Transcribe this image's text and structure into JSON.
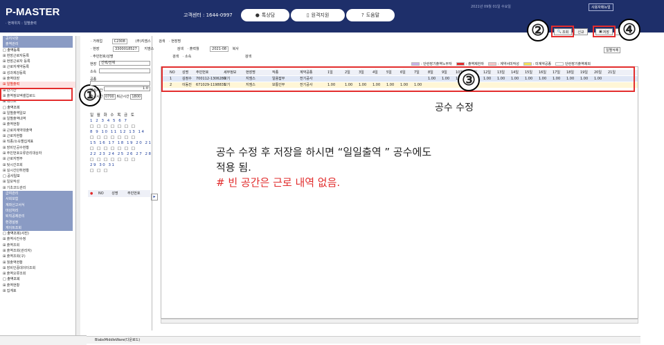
{
  "header": {
    "logo": "P-MASTER",
    "location": "· 현재위치 : 일별출력",
    "call_center": "고객센터 : 1644-0997",
    "btn1": "톡상담",
    "btn2": "원격지원",
    "btn3": "도움말",
    "date_text": "2021년 09월 01일 수요일",
    "user_tag": "사용자매뉴얼"
  },
  "toolbar": {
    "search": "조회",
    "init": "신규",
    "save": "저장",
    "third": "인쇄"
  },
  "callouts": {
    "c1": "①",
    "c2": "②",
    "c3": "③",
    "c4": "④"
  },
  "form": {
    "l1": "· 거래업",
    "v1a": "C2308",
    "v1b": "(주)지엠스",
    "search1": "검색",
    "l2": "· 현장",
    "v2a": "3300018527",
    "v2b": "지엠스",
    "search2": "검색",
    "l3": "· 주민번호/성명",
    "l4": "· 현장명",
    "l5": "· 출력월",
    "v5": "2021-08",
    "copy": "복사",
    "l6": "· 소속",
    "search3": "검색"
  },
  "daily_btn": "일별삭제",
  "legend": [
    {
      "color": "#c8b4e6",
      "label": ": 단란장기출역노무자"
    },
    {
      "color": "#e32c2c",
      "label": ": 출역제한자"
    },
    {
      "color": "#f2c6c6",
      "label": ": 계약서미작성"
    },
    {
      "color": "#f3e05a",
      "label": ": 미계약공종"
    },
    {
      "color": "#ffffff",
      "label": "단란장기출역제외"
    }
  ],
  "grid": {
    "headers": [
      "NO",
      "성명",
      "주민번호",
      "세부정보",
      "현장명",
      "작종",
      "계약공종",
      "1일",
      "2일",
      "3일",
      "4일",
      "5일",
      "6일",
      "7일",
      "8일",
      "9일",
      "10일",
      "11일",
      "12일",
      "13일",
      "14일",
      "15일",
      "16일",
      "17일",
      "18일",
      "19일",
      "20일",
      "21일"
    ],
    "rows": [
      {
        "no": "1",
        "name": "김정수",
        "id": "700112-1306280",
        "info": "보기",
        "site": "지엠스",
        "job": "일용잡부",
        "contract": "전기공사",
        "days": [
          "",
          "",
          "",
          "",
          "",
          "",
          "",
          "1.00",
          "1.00",
          "1.00",
          "1.00",
          "1.00",
          "1.00",
          "1.00",
          "1.00",
          "1.00",
          "1.00",
          "1.00",
          "1.00",
          "1.00"
        ]
      },
      {
        "no": "2",
        "name": "이동진",
        "id": "671029-1198831",
        "info": "보기",
        "site": "지엠스",
        "job": "보통인부",
        "contract": "전기공사",
        "days": [
          "1.00",
          "1.00",
          "1.00",
          "1.00",
          "1.00",
          "1.00",
          "1.00",
          "",
          "",
          "",
          "",
          "",
          "",
          "",
          "",
          "",
          "",
          "",
          "",
          ""
        ]
      }
    ]
  },
  "left_panel": {
    "site_label": "현장",
    "site_value": "선택/전체",
    "org_label": "소속",
    "type_label": "공종",
    "lunch_label": "점심시간",
    "lunch_value": "1.0",
    "time_label": "출근시간",
    "time_in": "0700",
    "leave_label": "퇴근시간",
    "time_out": "1800",
    "week": "일 월 화 수 목 금 토",
    "cal_rows": [
      "1 2 3 4 5 6 7",
      "8 9 10 11 12 13 14",
      "15 16 17 18 19 20 21",
      "22 23 24 25 26 27 28",
      "29 30 31"
    ],
    "list_headers": [
      "NO",
      "성명",
      "주민번호"
    ]
  },
  "sidebar": [
    {
      "t": "sh",
      "label": "공지사항"
    },
    {
      "t": "sh",
      "label": "출역관리"
    },
    {
      "t": "sf",
      "label": "□ 출역등록"
    },
    {
      "t": "sc",
      "label": "⊞ 현장근로자등록"
    },
    {
      "t": "sc",
      "label": "⊞ 현장근로자 등록"
    },
    {
      "t": "sc",
      "label": "⊞ 근로자계약등록"
    },
    {
      "t": "sc",
      "label": "⊞ 성과제강등록"
    },
    {
      "t": "sc",
      "label": "⊞ 출역대장"
    },
    {
      "t": "sel",
      "label": "⊞ 일별출력"
    },
    {
      "t": "sc",
      "label": "⊞ 단기간"
    },
    {
      "t": "sc",
      "label": "⊞ 출역정보엑셀업로드"
    },
    {
      "t": "sc",
      "label": "⊞ 테스트"
    },
    {
      "t": "sf",
      "label": "□ 출역조회"
    },
    {
      "t": "sc",
      "label": "⊞ 일별출역일보"
    },
    {
      "t": "sc",
      "label": "⊞ 일별출역내역"
    },
    {
      "t": "sc",
      "label": "⊞ 출역현황"
    },
    {
      "t": "sc",
      "label": "⊞ 근로자계약대출역"
    },
    {
      "t": "sc",
      "label": "⊞ 근로자현황"
    },
    {
      "t": "sc",
      "label": "⊞ 직종/소속별집계표"
    },
    {
      "t": "sc",
      "label": "⊞ 장비인공수현황"
    },
    {
      "t": "sc",
      "label": "⊞ 주민번호오류관리대상자"
    },
    {
      "t": "sc",
      "label": "⊞ 근로자명부"
    },
    {
      "t": "sc",
      "label": "⊞ 텃시간조회"
    },
    {
      "t": "sc",
      "label": "⊞ 실시간단취현황"
    },
    {
      "t": "sf",
      "label": "□ 공사일보"
    },
    {
      "t": "sc",
      "label": "⊞ 일보작성"
    },
    {
      "t": "sc",
      "label": "⊞ 기초코드관리"
    },
    {
      "t": "sh",
      "label": "급여관리"
    },
    {
      "t": "sh",
      "label": "사회보험"
    },
    {
      "t": "sh",
      "label": "계좌신고서식"
    },
    {
      "t": "sh",
      "label": "마감처리"
    },
    {
      "t": "sh",
      "label": "퇴직공제관리"
    },
    {
      "t": "sh",
      "label": "환경설정"
    },
    {
      "t": "sh",
      "label": "게이트조회"
    },
    {
      "t": "sf",
      "label": "□ 출역조회(사진)"
    },
    {
      "t": "sc",
      "label": "⊞ 출역사진수정"
    },
    {
      "t": "sc",
      "label": "⊞ 출역조회"
    },
    {
      "t": "sc",
      "label": "⊞ 출역조회(관리자)"
    },
    {
      "t": "sc",
      "label": "⊞ 출역조회(구)"
    },
    {
      "t": "sc",
      "label": "⊞ 월출역현황"
    },
    {
      "t": "sc",
      "label": "⊞ 장비인증데이터조회"
    },
    {
      "t": "sc",
      "label": "⊞ 출역오류조회"
    },
    {
      "t": "sf",
      "label": "□ 출역조회"
    },
    {
      "t": "sc",
      "label": "⊞ 출역현황"
    },
    {
      "t": "sc",
      "label": "⊞ 집계표"
    }
  ],
  "notes": {
    "small": "공수 수정",
    "line1": "공수 수정 후 저장을 하시면 “일일출역 ” 공수에도",
    "line2": "적용 됨.",
    "line3": "# 빈 공간은 근로 내역 없음."
  },
  "footer": "BlabsMiddleWare(다운로드)"
}
